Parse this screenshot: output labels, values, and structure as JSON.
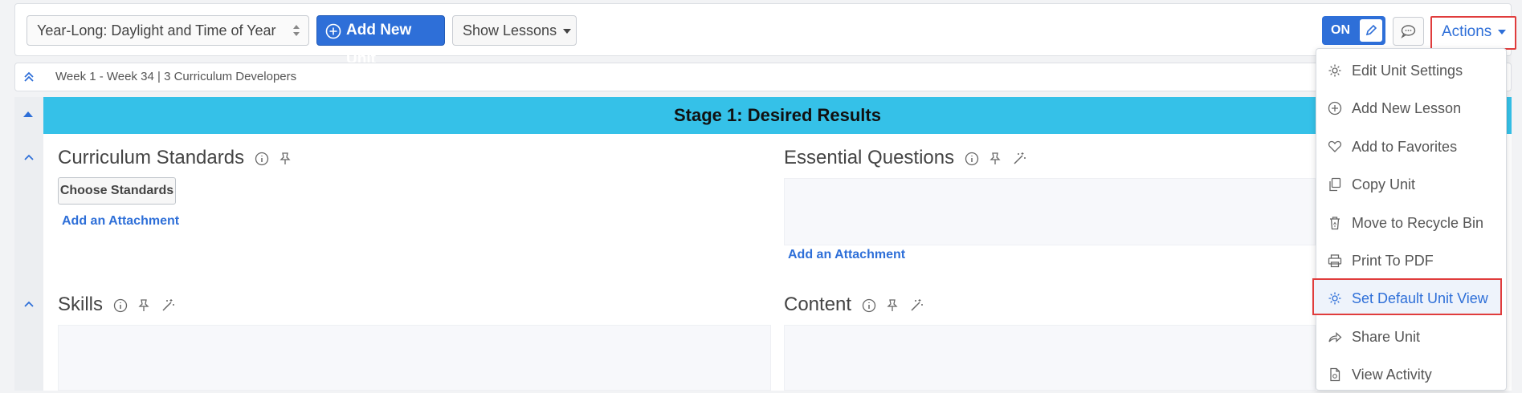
{
  "toolbar": {
    "unit_select": "Year-Long: Daylight and Time of Year",
    "add_unit_label": "Add New Unit",
    "show_lessons_label": "Show Lessons",
    "toggle_label": "ON",
    "actions_label": "Actions"
  },
  "infobar": {
    "text": "Week 1 - Week 34 |  3 Curriculum Developers"
  },
  "stage": {
    "title": "Stage 1: Desired Results",
    "sections": {
      "standards": {
        "title": "Curriculum Standards",
        "button": "Choose Standards",
        "attach": "Add an Attachment"
      },
      "questions": {
        "title": "Essential Questions",
        "attach": "Add an Attachment"
      },
      "skills": {
        "title": "Skills"
      },
      "content": {
        "title": "Content"
      }
    }
  },
  "menu": {
    "items": [
      {
        "label": "Edit Unit Settings",
        "icon": "gear-icon"
      },
      {
        "label": "Add New Lesson",
        "icon": "plus-circle-icon"
      },
      {
        "label": "Add to Favorites",
        "icon": "heart-icon"
      },
      {
        "label": "Copy Unit",
        "icon": "copy-icon"
      },
      {
        "label": "Move to Recycle Bin",
        "icon": "recycle-bin-icon"
      },
      {
        "label": "Print To PDF",
        "icon": "printer-icon"
      },
      {
        "label": "Set Default Unit View",
        "icon": "gear-icon"
      },
      {
        "label": "Share Unit",
        "icon": "share-icon"
      },
      {
        "label": "View Activity",
        "icon": "activity-icon"
      }
    ]
  },
  "colors": {
    "primary": "#2e6fd8",
    "stage_bar": "#35c1e8",
    "highlight_border": "#e03c3c"
  }
}
